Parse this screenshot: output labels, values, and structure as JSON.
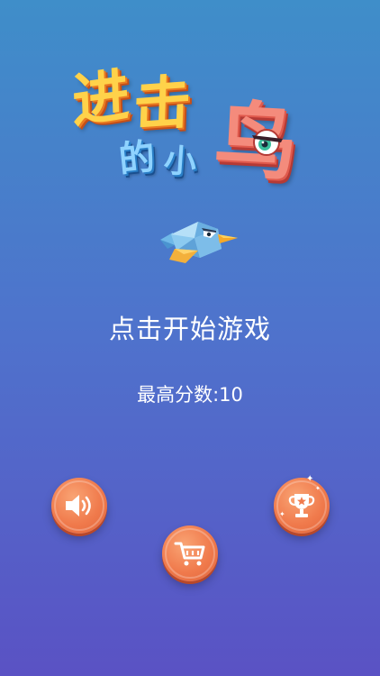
{
  "logo": {
    "char1": "进",
    "char2": "击",
    "char3": "的",
    "char4": "小",
    "char5": "鸟"
  },
  "main": {
    "tap_to_start": "点击开始游戏",
    "best_score": "最高分数:10"
  },
  "buttons": {
    "sound_icon": "speaker-icon",
    "shop_icon": "shopping-cart-icon",
    "leaderboard_icon": "trophy-icon"
  },
  "colors": {
    "background_top": "#3f8ec9",
    "background_bottom": "#5a52c4",
    "button_orange": "#f07a4c",
    "text": "#ffffff"
  }
}
